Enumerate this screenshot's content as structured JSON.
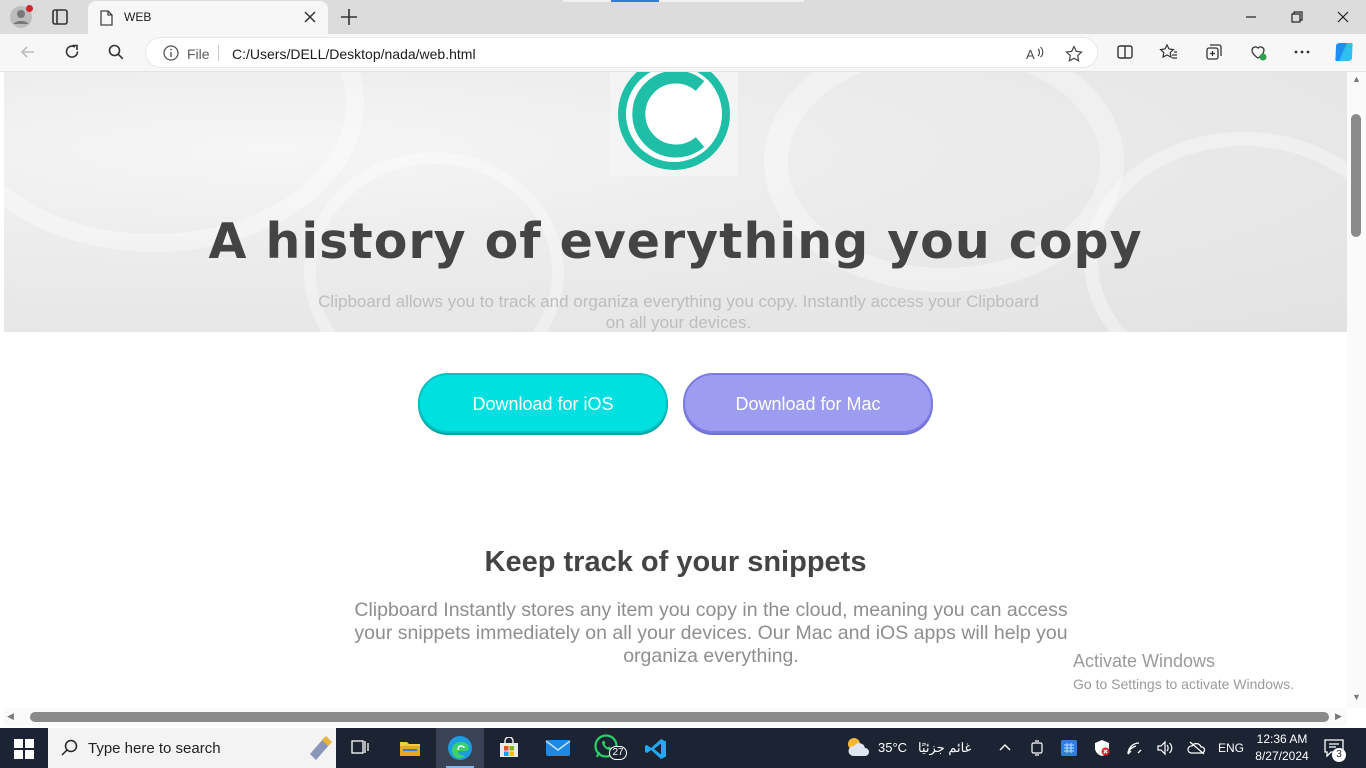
{
  "browser": {
    "tab_title": "WEB",
    "address": {
      "scheme_label": "File",
      "url": "C:/Users/DELL/Desktop/nada/web.html"
    }
  },
  "page": {
    "headline": "A history of everything you copy",
    "hero_subtitle": "Clipboard allows you to track and organiza everything you copy. Instantly access your Clipboard on all your devices.",
    "buttons": {
      "ios": "Download for iOS",
      "mac": "Download for Mac"
    },
    "section": {
      "title": "Keep track of your snippets",
      "text": "Clipboard Instantly stores any item you copy in the cloud, meaning you can access your snippets immediately on all your devices. Our Mac and iOS apps will help you organiza everything."
    },
    "colors": {
      "logo": "#1fbea6",
      "ios_button": "#00e0e0",
      "mac_button": "#9c9cf0",
      "heading": "#444444"
    }
  },
  "watermark": {
    "line1": "Activate Windows",
    "line2": "Go to Settings to activate Windows."
  },
  "taskbar": {
    "search_placeholder": "Type here to search",
    "whatsapp_badge": "27",
    "weather_temp": "35°C",
    "weather_desc": "غائم جزئيًا",
    "language": "ENG",
    "time": "12:36 AM",
    "date": "8/27/2024",
    "notification_count": "3"
  }
}
